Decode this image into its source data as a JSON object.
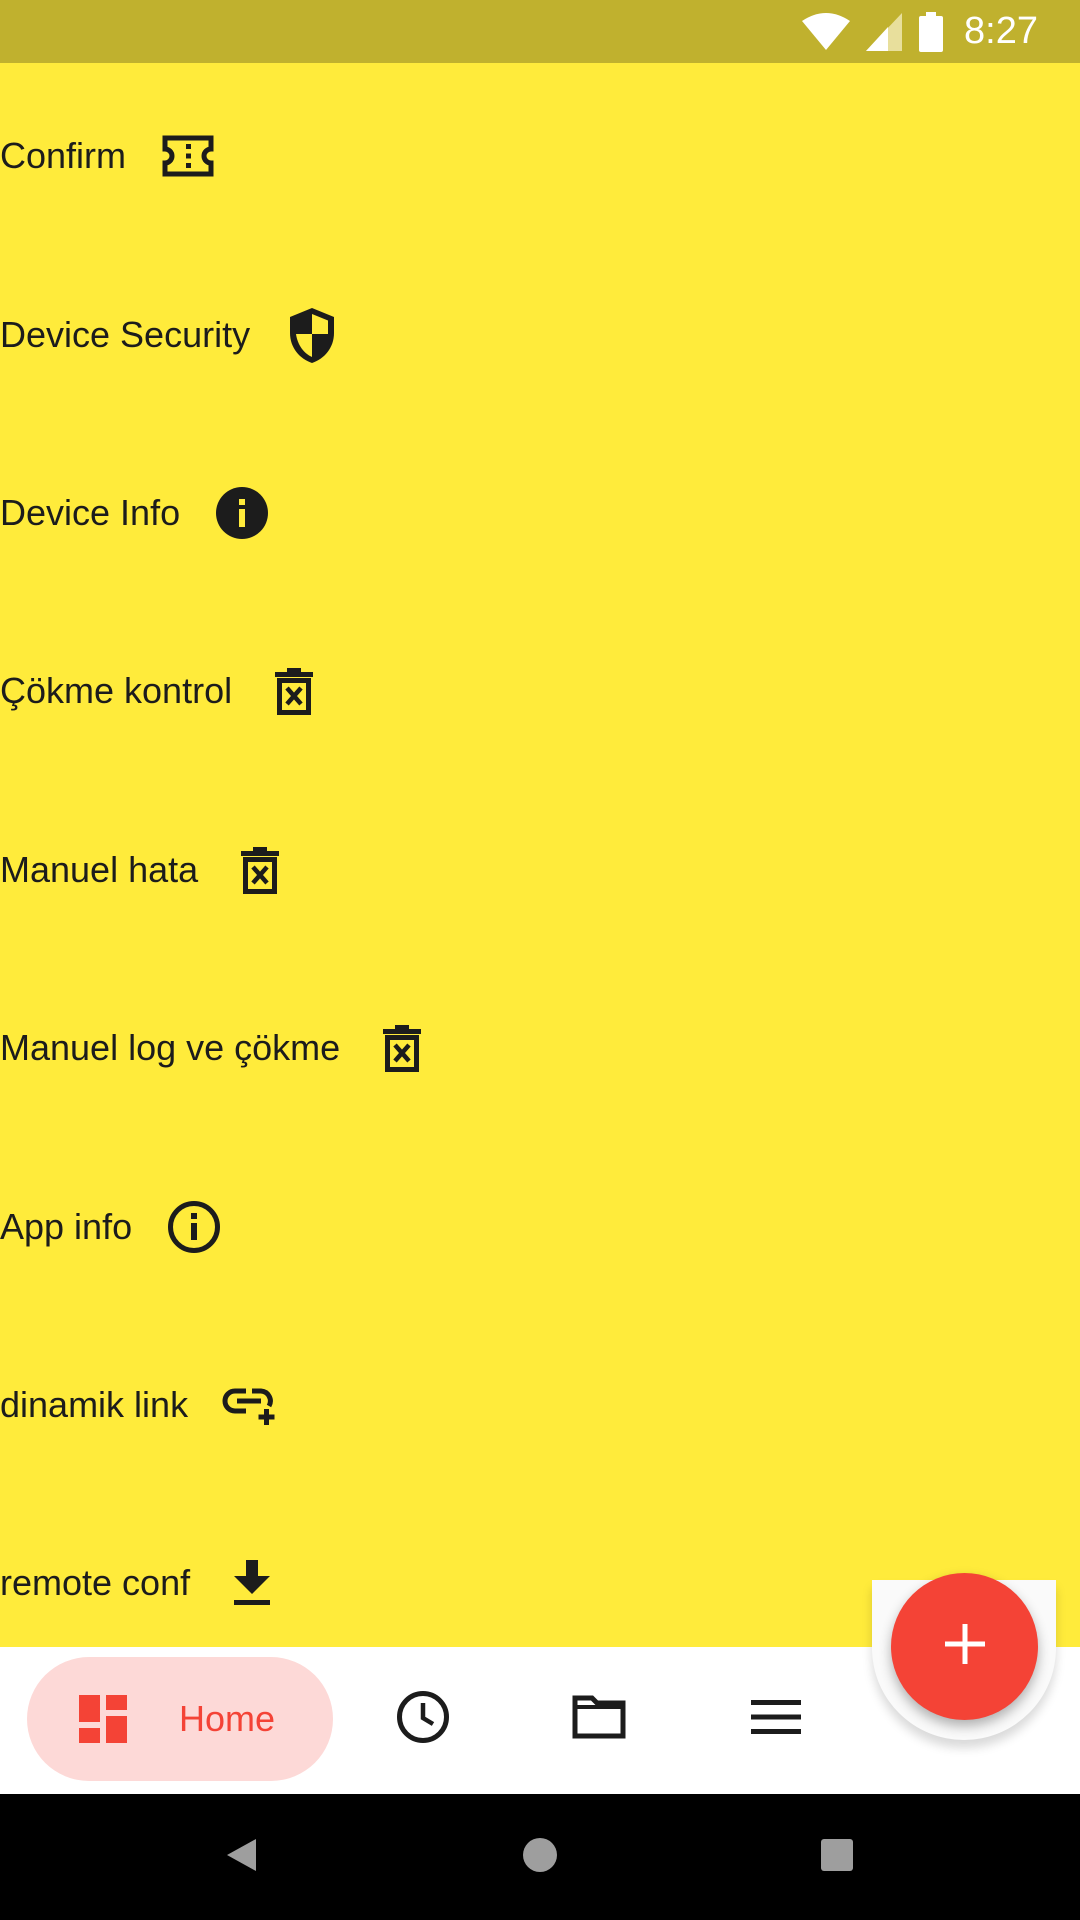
{
  "status_bar": {
    "time": "8:27",
    "icons": [
      "wifi-icon",
      "cell-signal-icon",
      "battery-icon"
    ]
  },
  "menu": {
    "items": [
      {
        "label": "Confirm",
        "icon": "ticket-icon"
      },
      {
        "label": "Device Security",
        "icon": "shield-icon"
      },
      {
        "label": "Device Info",
        "icon": "info-filled-icon"
      },
      {
        "label": "Çökme kontrol",
        "icon": "delete-forever-icon"
      },
      {
        "label": "Manuel hata",
        "icon": "delete-forever-icon"
      },
      {
        "label": "Manuel log ve çökme",
        "icon": "delete-forever-icon"
      },
      {
        "label": "App info",
        "icon": "info-outline-icon"
      },
      {
        "label": "dinamik link",
        "icon": "add-link-icon"
      },
      {
        "label": "remote conf",
        "icon": "download-icon"
      }
    ]
  },
  "bottom_nav": {
    "items": [
      {
        "label": "Home",
        "icon": "dashboard-icon",
        "selected": true
      },
      {
        "label": "",
        "icon": "clock-icon"
      },
      {
        "label": "",
        "icon": "folder-icon"
      },
      {
        "label": "",
        "icon": "menu-icon"
      }
    ]
  },
  "fab": {
    "icon": "plus-icon"
  },
  "colors": {
    "background": "#ffeb3b",
    "status_bar": "#c0b12e",
    "accent": "#f44336",
    "home_pill": "#fdd9d7"
  }
}
